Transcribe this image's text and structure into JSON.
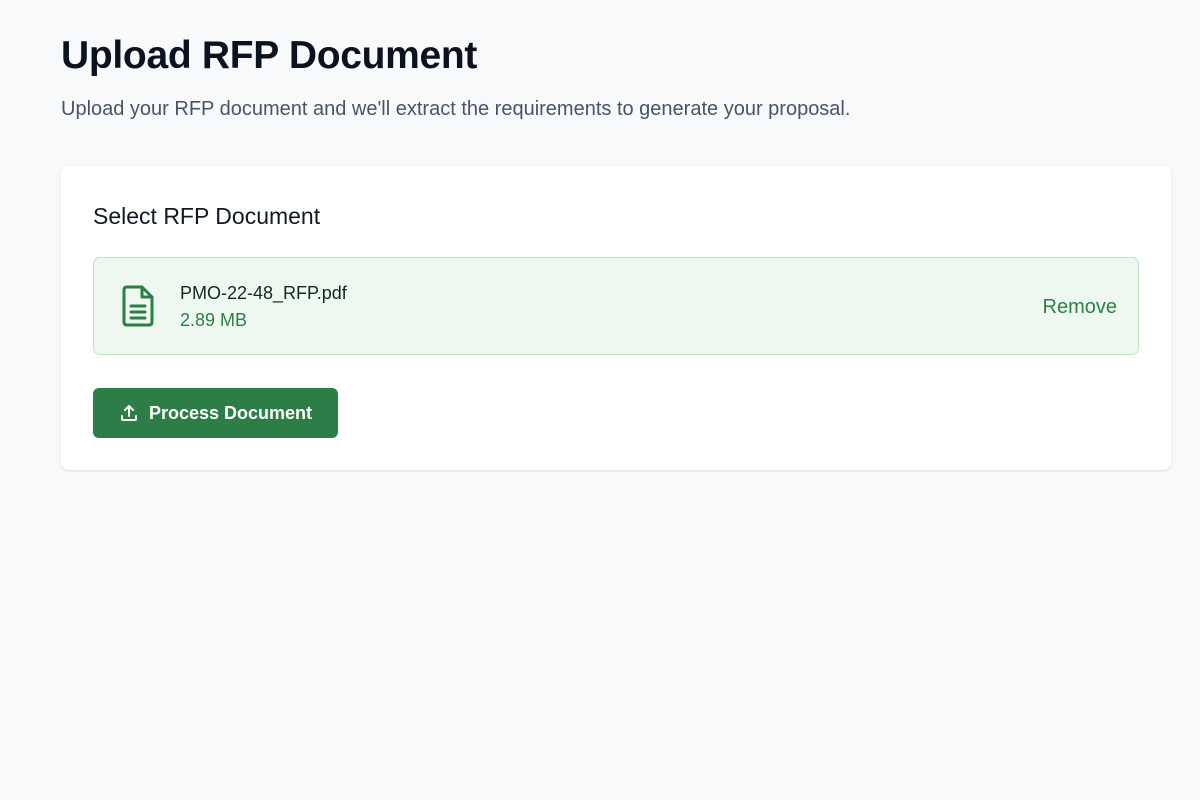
{
  "header": {
    "title": "Upload RFP Document",
    "subtitle": "Upload your RFP document and we'll extract the requirements to generate your proposal."
  },
  "card": {
    "title": "Select RFP Document",
    "file": {
      "icon": "file-text-icon",
      "name": "PMO-22-48_RFP.pdf",
      "size": "2.89 MB",
      "remove_label": "Remove"
    },
    "process_button": {
      "icon": "upload-icon",
      "label": "Process Document"
    }
  },
  "colors": {
    "accent": "#2d7d46",
    "file_row_background": "#eef8f1",
    "file_row_border": "#bfe3c8",
    "page_background": "#f8f9fb"
  }
}
